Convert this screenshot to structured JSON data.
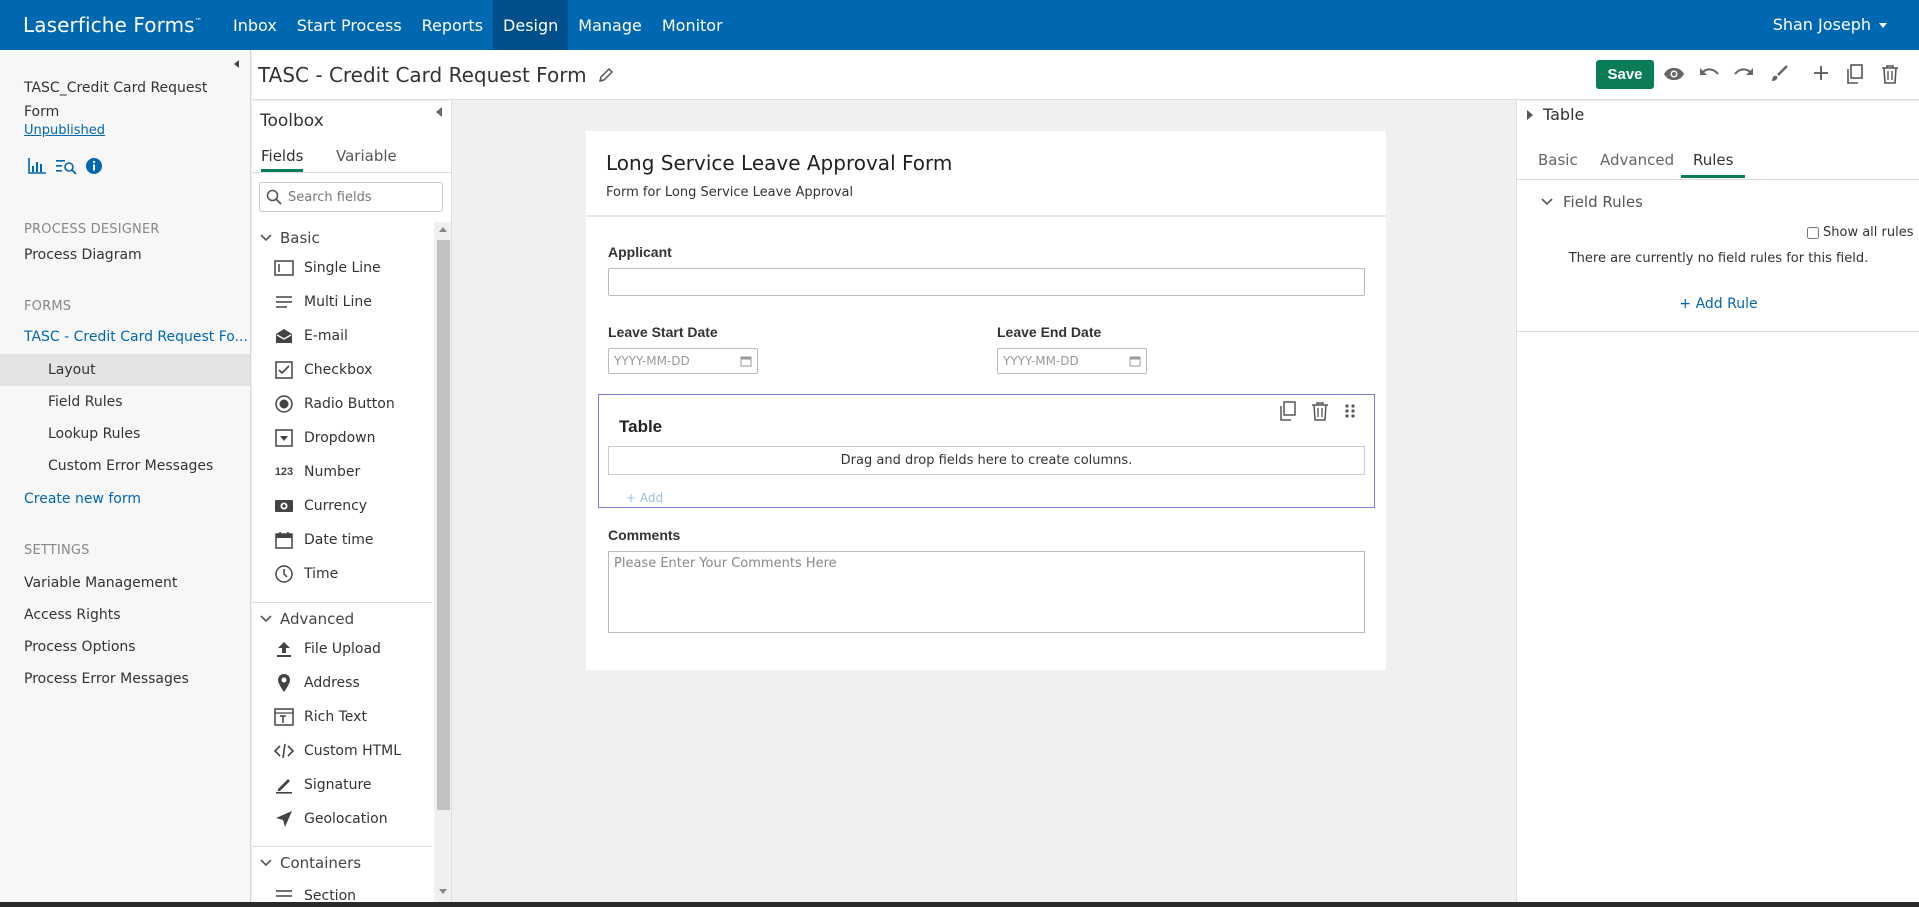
{
  "app": {
    "brand": "Laserfiche Forms",
    "trademark": "™"
  },
  "nav": {
    "items": [
      {
        "label": "Inbox"
      },
      {
        "label": "Start Process"
      },
      {
        "label": "Reports"
      },
      {
        "label": "Design"
      },
      {
        "label": "Manage"
      },
      {
        "label": "Monitor"
      }
    ],
    "active": "Design",
    "user": "Shan Joseph"
  },
  "sidebar": {
    "process_name": "TASC_Credit Card Request Form",
    "status_link": "Unpublished",
    "sections": {
      "process_designer": "PROCESS DESIGNER",
      "forms": "FORMS",
      "settings": "SETTINGS"
    },
    "process_diagram": "Process Diagram",
    "current_form": "TASC - Credit Card Request Fo...",
    "form_items": [
      {
        "label": "Layout"
      },
      {
        "label": "Field Rules"
      },
      {
        "label": "Lookup Rules"
      },
      {
        "label": "Custom Error Messages"
      }
    ],
    "create_new": "Create new form",
    "settings_items": [
      {
        "label": "Variable Management"
      },
      {
        "label": "Access Rights"
      },
      {
        "label": "Process Options"
      },
      {
        "label": "Process Error Messages"
      }
    ]
  },
  "header": {
    "form_title": "TASC - Credit Card Request Form",
    "save_label": "Save"
  },
  "toolbox": {
    "title": "Toolbox",
    "tabs": [
      {
        "label": "Fields"
      },
      {
        "label": "Variable"
      }
    ],
    "search_placeholder": "Search fields",
    "basic_label": "Basic",
    "basic_items": [
      {
        "label": "Single Line",
        "icon": "single-line-icon"
      },
      {
        "label": "Multi Line",
        "icon": "multi-line-icon"
      },
      {
        "label": "E-mail",
        "icon": "email-icon"
      },
      {
        "label": "Checkbox",
        "icon": "checkbox-icon"
      },
      {
        "label": "Radio Button",
        "icon": "radio-button-icon"
      },
      {
        "label": "Dropdown",
        "icon": "dropdown-icon"
      },
      {
        "label": "Number",
        "icon": "number-icon"
      },
      {
        "label": "Currency",
        "icon": "currency-icon"
      },
      {
        "label": "Date time",
        "icon": "calendar-icon"
      },
      {
        "label": "Time",
        "icon": "clock-icon"
      }
    ],
    "advanced_label": "Advanced",
    "advanced_items": [
      {
        "label": "File Upload",
        "icon": "upload-icon"
      },
      {
        "label": "Address",
        "icon": "location-pin-icon"
      },
      {
        "label": "Rich Text",
        "icon": "rich-text-icon"
      },
      {
        "label": "Custom HTML",
        "icon": "code-icon"
      },
      {
        "label": "Signature",
        "icon": "pen-icon"
      },
      {
        "label": "Geolocation",
        "icon": "navigation-arrow-icon"
      }
    ],
    "containers_label": "Containers",
    "containers_items": [
      {
        "label": "Section"
      }
    ]
  },
  "form": {
    "title": "Long Service Leave Approval Form",
    "description": "Form for Long Service Leave Approval",
    "applicant_label": "Applicant",
    "leave_start_label": "Leave Start Date",
    "leave_end_label": "Leave End Date",
    "date_placeholder": "YYYY-MM-DD",
    "table": {
      "title": "Table",
      "drop_hint": "Drag and drop fields here to create columns.",
      "add_label": "+ Add"
    },
    "comments_label": "Comments",
    "comments_placeholder": "Please Enter Your Comments Here"
  },
  "properties": {
    "title": "Table",
    "tabs": [
      {
        "label": "Basic"
      },
      {
        "label": "Advanced"
      },
      {
        "label": "Rules"
      }
    ],
    "active_tab": "Rules",
    "field_rules_label": "Field Rules",
    "show_all_label": "Show all rules",
    "empty_message": "There are currently no field rules for this field.",
    "add_rule_label": "+ Add Rule"
  },
  "colors": {
    "brand_blue": "#0067b1",
    "save_green": "#0a7d55",
    "selected_outline": "#7a7fd0"
  }
}
